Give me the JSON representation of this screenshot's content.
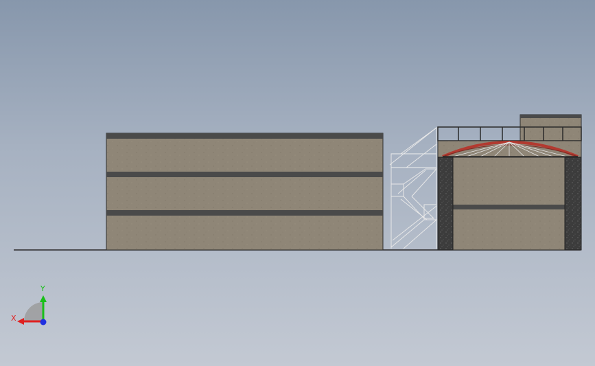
{
  "viewport": {
    "background_top": "#8797ac",
    "background_bottom": "#c3c9d3"
  },
  "model": {
    "view": "elevation",
    "concrete_color": "#8f8677",
    "slab_color": "#4a4a4a",
    "column_color": "#3c3c3c",
    "arch_color": "#b33a30",
    "rail_color": "#e8e8e8"
  },
  "triad": {
    "x_label": "X",
    "y_label": "Y",
    "x_color": "#e02020",
    "y_color": "#18c018",
    "z_color": "#2030e0"
  }
}
